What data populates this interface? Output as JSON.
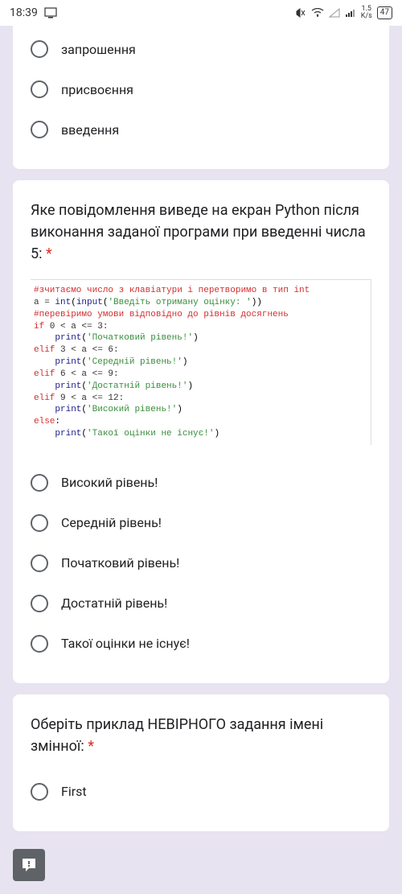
{
  "statusBar": {
    "time": "18:39",
    "netSpeed": "1.5",
    "netUnit": "K/s",
    "battery": "47"
  },
  "card1": {
    "options": [
      "запрошення",
      "присвоєння",
      "введення"
    ]
  },
  "card2": {
    "question": "Яке повідомлення виведе на екран Python після виконання заданої програми при введенні числа 5:",
    "code": {
      "c1": "#зчитаємо число з клавіатури і перетворимо в тип int",
      "l2_var": "a = ",
      "l2_int": "int",
      "l2_input": "input",
      "l2_str": "'Введіть отриману оцінку: '",
      "c3": "#перевіримо умови відповідно до рівнів досягнень",
      "k_if": "if",
      "k_elif": "elif",
      "k_else": "else",
      "k_print": "print",
      "cond1": " 0 < a <= 3:",
      "s1": "'Початковий рівень!'",
      "cond2": " 3 < a <= 6:",
      "s2": "'Середній рівень!'",
      "cond3": " 6 < a <= 9:",
      "s3": "'Достатній рівень!'",
      "cond4": " 9 < a <= 12:",
      "s4": "'Високий рівень!'",
      "s5": "'Такої оцінки не існує!'"
    },
    "options": [
      "Високий рівень!",
      "Середній рівень!",
      "Початковий рівень!",
      "Достатній рівень!",
      "Такої оцінки не існує!"
    ]
  },
  "card3": {
    "question": "Оберіть приклад НЕВІРНОГО задання імені змінної:",
    "options": [
      "First"
    ]
  }
}
